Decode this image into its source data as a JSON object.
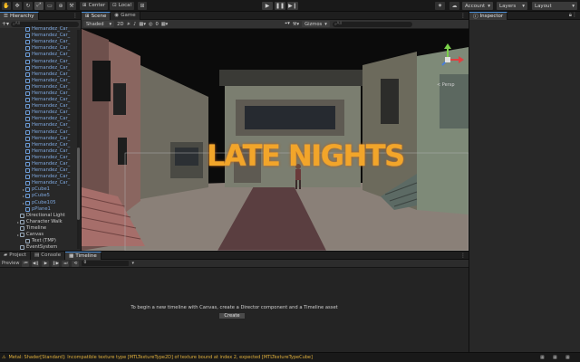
{
  "toolbar": {
    "pivot_label": "Center",
    "space_label": "Local",
    "account_label": "Account",
    "layers_label": "Layers",
    "layout_label": "Layout"
  },
  "hierarchy": {
    "tab_label": "Hierarchy",
    "search_placeholder": "All",
    "items": [
      {
        "label": "Hernandez_Car_",
        "blue": true,
        "indent": 1
      },
      {
        "label": "Hernandez_Car_",
        "blue": true,
        "indent": 1
      },
      {
        "label": "Hernandez_Car_",
        "blue": true,
        "indent": 1
      },
      {
        "label": "Hernandez_Car_",
        "blue": true,
        "indent": 1
      },
      {
        "label": "Hernandez_Car_",
        "blue": true,
        "indent": 1
      },
      {
        "label": "Hernandez_Car_",
        "blue": true,
        "indent": 1
      },
      {
        "label": "Hernandez_Car_",
        "blue": true,
        "indent": 1
      },
      {
        "label": "Hernandez_Car_",
        "blue": true,
        "indent": 1
      },
      {
        "label": "Hernandez_Car_",
        "blue": true,
        "indent": 1
      },
      {
        "label": "Hernandez_Car_",
        "blue": true,
        "indent": 1
      },
      {
        "label": "Hernandez_Car_",
        "blue": true,
        "indent": 1
      },
      {
        "label": "Hernandez_Car_",
        "blue": true,
        "indent": 1
      },
      {
        "label": "Hernandez_Car_",
        "blue": true,
        "indent": 1
      },
      {
        "label": "Hernandez_Car_",
        "blue": true,
        "indent": 1
      },
      {
        "label": "Hernandez_Car_",
        "blue": true,
        "indent": 1
      },
      {
        "label": "Hernandez_Car_",
        "blue": true,
        "indent": 1
      },
      {
        "label": "Hernandez_Car_",
        "blue": true,
        "indent": 1
      },
      {
        "label": "Hernandez_Car_",
        "blue": true,
        "indent": 1
      },
      {
        "label": "Hernandez_Car_",
        "blue": true,
        "indent": 1
      },
      {
        "label": "Hernandez_Car_",
        "blue": true,
        "indent": 1
      },
      {
        "label": "Hernandez_Car_",
        "blue": true,
        "indent": 1
      },
      {
        "label": "Hernandez_Car_",
        "blue": true,
        "indent": 1
      },
      {
        "label": "Hernandez_Car_",
        "blue": true,
        "indent": 1
      },
      {
        "label": "Hernandez_Car_",
        "blue": true,
        "indent": 1
      },
      {
        "label": "Hernandez_Car_",
        "blue": true,
        "indent": 1
      },
      {
        "label": "pCube1",
        "blue": true,
        "indent": 1,
        "fold": true
      },
      {
        "label": "pCube5",
        "blue": true,
        "indent": 1,
        "fold": true
      },
      {
        "label": "pCube105",
        "blue": true,
        "indent": 1,
        "fold": true
      },
      {
        "label": "pPlane1",
        "blue": true,
        "indent": 1
      },
      {
        "label": "Directional Light",
        "blue": false,
        "indent": 0
      },
      {
        "label": "Character Walk",
        "blue": false,
        "indent": 0,
        "fold": true
      },
      {
        "label": "Timeline",
        "blue": false,
        "indent": 0
      },
      {
        "label": "Canvas",
        "blue": false,
        "indent": 0,
        "fold": true
      },
      {
        "label": "Text (TMP)",
        "blue": false,
        "indent": 1
      },
      {
        "label": "EventSystem",
        "blue": false,
        "indent": 0
      }
    ]
  },
  "scene": {
    "tab_scene": "Scene",
    "tab_game": "Game",
    "shading_mode": "Shaded",
    "dimension": "2D",
    "gizmos_label": "Gizmos",
    "search_placeholder": "All",
    "persp_label": "< Persp",
    "overlay_title": "LATE NIGHTS",
    "counter": "0"
  },
  "inspector": {
    "tab_label": "Inspector"
  },
  "bottom": {
    "tabs": [
      "Project",
      "Console",
      "Timeline"
    ],
    "preview_label": "Preview",
    "frame_value": "0",
    "message": "To begin a new timeline with Canvas, create a Director component and a Timeline asset",
    "create_label": "Create"
  },
  "status": {
    "message": "Metal: Shader[Standard]: Incompatible texture type [MTLTextureType2D] of texture bound at index 2, expected [MTLTextureTypeCube]"
  },
  "colors": {
    "accent": "#4a8ed6",
    "title_orange": "#f2a52a",
    "warning": "#e0b03c"
  }
}
